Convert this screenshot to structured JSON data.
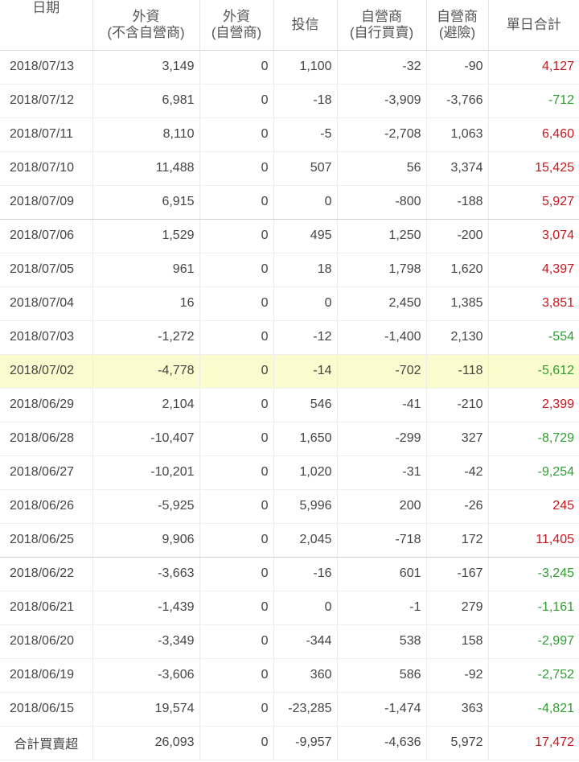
{
  "headers": {
    "date": "日期",
    "foreign_ex_dealer": [
      "外資",
      "(不含自營商)"
    ],
    "foreign_dealer": [
      "外資",
      "(自營商)"
    ],
    "investment_trust": "投信",
    "dealer_self": [
      "自營商",
      "(自行買賣)"
    ],
    "dealer_hedge": [
      "自營商",
      "(避險)"
    ],
    "daily_total": "單日合計"
  },
  "rows": [
    {
      "date": "2018/07/13",
      "foreign": "3,149",
      "foreign_dealer": "0",
      "trust": "1,100",
      "dealer_self": "-32",
      "dealer_hedge": "-90",
      "total": "4,127"
    },
    {
      "date": "2018/07/12",
      "foreign": "6,981",
      "foreign_dealer": "0",
      "trust": "-18",
      "dealer_self": "-3,909",
      "dealer_hedge": "-3,766",
      "total": "-712"
    },
    {
      "date": "2018/07/11",
      "foreign": "8,110",
      "foreign_dealer": "0",
      "trust": "-5",
      "dealer_self": "-2,708",
      "dealer_hedge": "1,063",
      "total": "6,460"
    },
    {
      "date": "2018/07/10",
      "foreign": "11,488",
      "foreign_dealer": "0",
      "trust": "507",
      "dealer_self": "56",
      "dealer_hedge": "3,374",
      "total": "15,425"
    },
    {
      "date": "2018/07/09",
      "foreign": "6,915",
      "foreign_dealer": "0",
      "trust": "0",
      "dealer_self": "-800",
      "dealer_hedge": "-188",
      "total": "5,927"
    },
    {
      "date": "2018/07/06",
      "foreign": "1,529",
      "foreign_dealer": "0",
      "trust": "495",
      "dealer_self": "1,250",
      "dealer_hedge": "-200",
      "total": "3,074"
    },
    {
      "date": "2018/07/05",
      "foreign": "961",
      "foreign_dealer": "0",
      "trust": "18",
      "dealer_self": "1,798",
      "dealer_hedge": "1,620",
      "total": "4,397"
    },
    {
      "date": "2018/07/04",
      "foreign": "16",
      "foreign_dealer": "0",
      "trust": "0",
      "dealer_self": "2,450",
      "dealer_hedge": "1,385",
      "total": "3,851"
    },
    {
      "date": "2018/07/03",
      "foreign": "-1,272",
      "foreign_dealer": "0",
      "trust": "-12",
      "dealer_self": "-1,400",
      "dealer_hedge": "2,130",
      "total": "-554"
    },
    {
      "date": "2018/07/02",
      "foreign": "-4,778",
      "foreign_dealer": "0",
      "trust": "-14",
      "dealer_self": "-702",
      "dealer_hedge": "-118",
      "total": "-5,612"
    },
    {
      "date": "2018/06/29",
      "foreign": "2,104",
      "foreign_dealer": "0",
      "trust": "546",
      "dealer_self": "-41",
      "dealer_hedge": "-210",
      "total": "2,399"
    },
    {
      "date": "2018/06/28",
      "foreign": "-10,407",
      "foreign_dealer": "0",
      "trust": "1,650",
      "dealer_self": "-299",
      "dealer_hedge": "327",
      "total": "-8,729"
    },
    {
      "date": "2018/06/27",
      "foreign": "-10,201",
      "foreign_dealer": "0",
      "trust": "1,020",
      "dealer_self": "-31",
      "dealer_hedge": "-42",
      "total": "-9,254"
    },
    {
      "date": "2018/06/26",
      "foreign": "-5,925",
      "foreign_dealer": "0",
      "trust": "5,996",
      "dealer_self": "200",
      "dealer_hedge": "-26",
      "total": "245"
    },
    {
      "date": "2018/06/25",
      "foreign": "9,906",
      "foreign_dealer": "0",
      "trust": "2,045",
      "dealer_self": "-718",
      "dealer_hedge": "172",
      "total": "11,405"
    },
    {
      "date": "2018/06/22",
      "foreign": "-3,663",
      "foreign_dealer": "0",
      "trust": "-16",
      "dealer_self": "601",
      "dealer_hedge": "-167",
      "total": "-3,245"
    },
    {
      "date": "2018/06/21",
      "foreign": "-1,439",
      "foreign_dealer": "0",
      "trust": "0",
      "dealer_self": "-1",
      "dealer_hedge": "279",
      "total": "-1,161"
    },
    {
      "date": "2018/06/20",
      "foreign": "-3,349",
      "foreign_dealer": "0",
      "trust": "-344",
      "dealer_self": "538",
      "dealer_hedge": "158",
      "total": "-2,997"
    },
    {
      "date": "2018/06/19",
      "foreign": "-3,606",
      "foreign_dealer": "0",
      "trust": "360",
      "dealer_self": "586",
      "dealer_hedge": "-92",
      "total": "-2,752"
    },
    {
      "date": "2018/06/15",
      "foreign": "19,574",
      "foreign_dealer": "0",
      "trust": "-23,285",
      "dealer_self": "-1,474",
      "dealer_hedge": "363",
      "total": "-4,821"
    }
  ],
  "total_row": {
    "label": "合計買賣超",
    "foreign": "26,093",
    "foreign_dealer": "0",
    "trust": "-9,957",
    "dealer_self": "-4,636",
    "dealer_hedge": "5,972",
    "total": "17,472"
  },
  "highlighted_date": "2018/07/02",
  "week_end_dates": [
    "2018/07/09",
    "2018/06/25"
  ],
  "colors": {
    "positive": "#c8161d",
    "negative": "#2e9e2e",
    "highlight": "#fbfbd0"
  }
}
